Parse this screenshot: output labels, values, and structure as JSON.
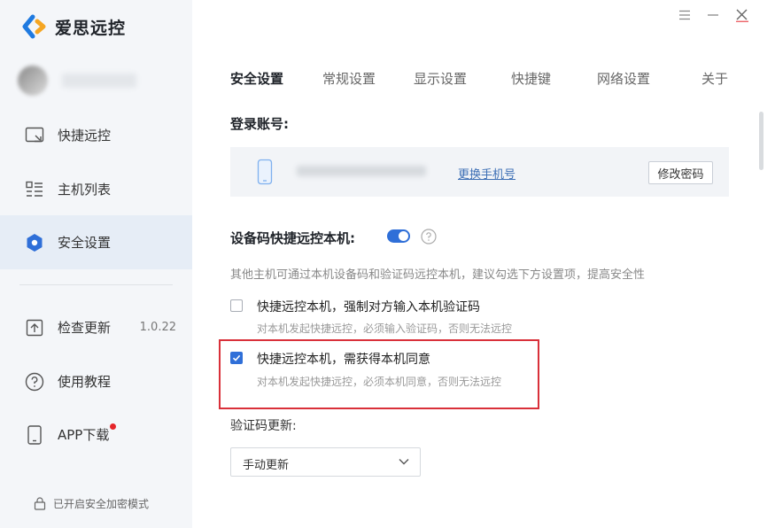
{
  "app": {
    "name": "爱思远控",
    "brand_colors": {
      "left": "#1f7ae0",
      "right": "#f5a623"
    }
  },
  "window_controls": {
    "menu_icon": "menu-icon",
    "minimize_icon": "minimize-icon",
    "close_icon": "close-icon"
  },
  "sidebar": {
    "items": [
      {
        "label": "快捷远控",
        "icon": "remote-screen-icon"
      },
      {
        "label": "主机列表",
        "icon": "list-icon"
      },
      {
        "label": "安全设置",
        "icon": "shield-icon",
        "active": true
      },
      {
        "label": "检查更新",
        "icon": "upload-icon",
        "extra": "1.0.22"
      },
      {
        "label": "使用教程",
        "icon": "question-icon"
      },
      {
        "label": "APP下载",
        "icon": "phone-icon",
        "badge": "red-dot"
      }
    ],
    "secure_mode": "已开启安全加密模式"
  },
  "tabs": [
    {
      "label": "安全设置",
      "active": true
    },
    {
      "label": "常规设置"
    },
    {
      "label": "显示设置"
    },
    {
      "label": "快捷键"
    },
    {
      "label": "网络设置"
    },
    {
      "label": "关于"
    }
  ],
  "account": {
    "title": "登录账号:",
    "change_phone": "更换手机号",
    "change_password": "修改密码"
  },
  "quick_remote": {
    "title": "设备码快捷远控本机:",
    "toggle_on": true,
    "description": "其他主机可通过本机设备码和验证码远控本机，建议勾选下方设置项，提高安全性",
    "options": [
      {
        "label": "快捷远控本机，强制对方输入本机验证码",
        "sub": "对本机发起快捷远控，必须输入验证码，否则无法远控",
        "checked": false
      },
      {
        "label": "快捷远控本机，需获得本机同意",
        "sub": "对本机发起快捷远控，必须本机同意，否则无法远控",
        "checked": true
      }
    ]
  },
  "verify_code": {
    "label": "验证码更新:",
    "selected": "手动更新"
  }
}
